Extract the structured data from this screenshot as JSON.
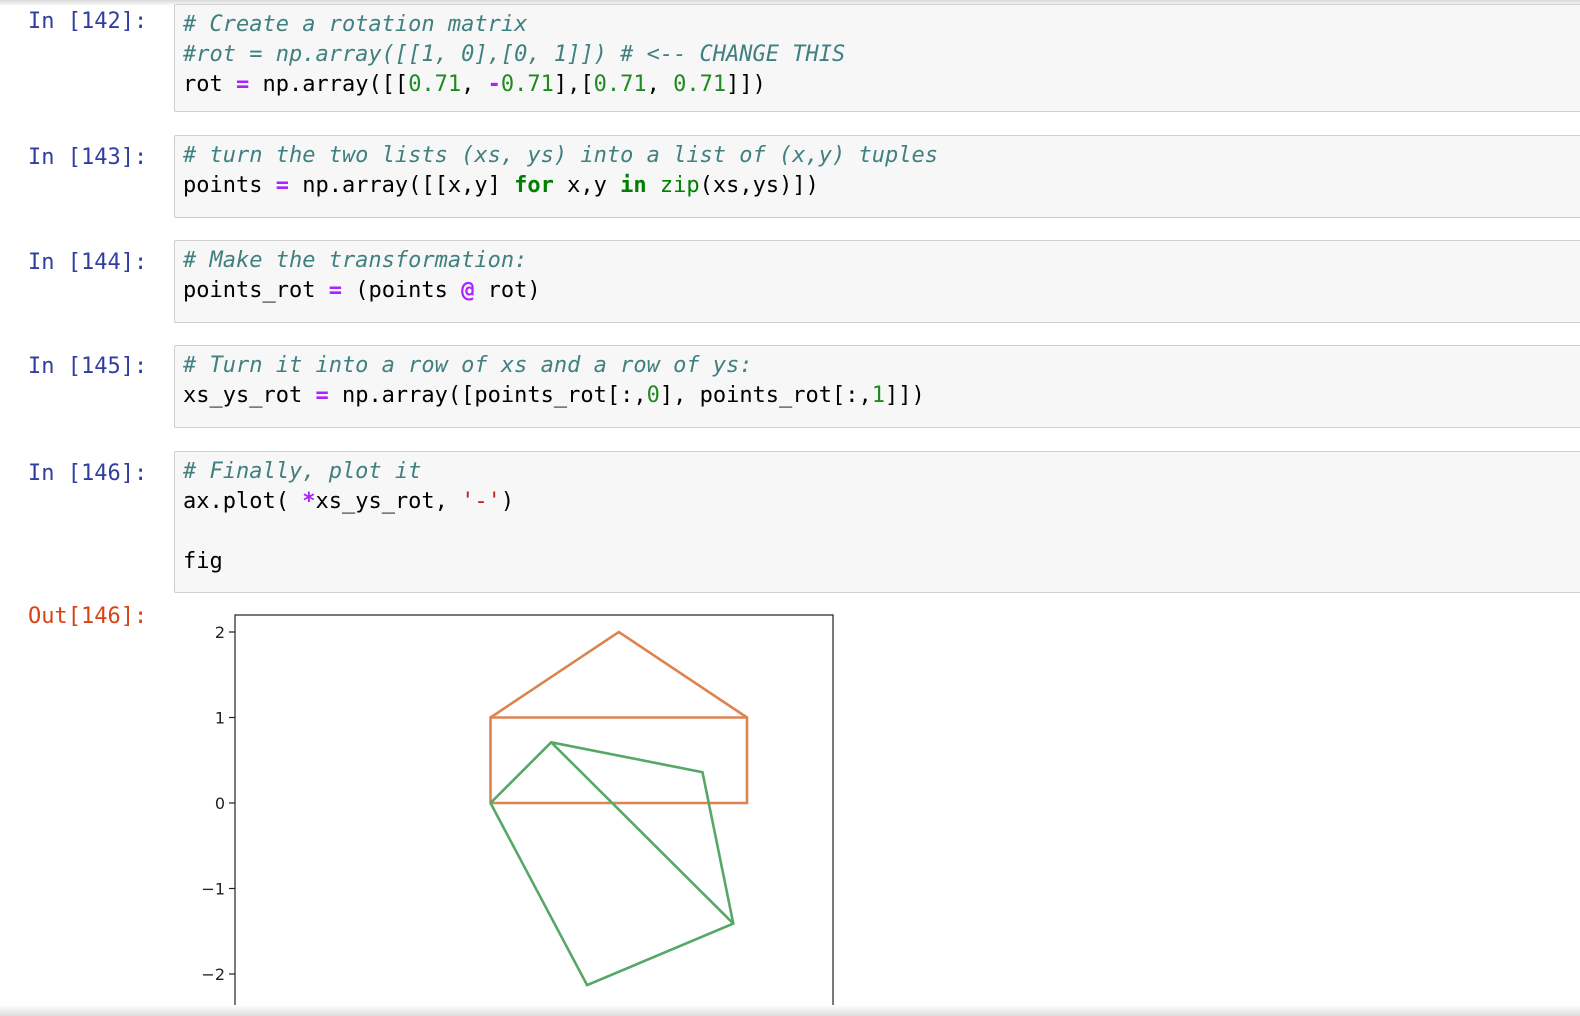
{
  "cells": [
    {
      "prompt": "In [142]:",
      "lines": [
        [
          [
            "cm",
            "# Create a rotation matrix"
          ]
        ],
        [
          [
            "cm",
            "#rot = np.array([[1, 0],[0, 1]]) # <-- CHANGE THIS"
          ]
        ],
        [
          [
            "t",
            "rot "
          ],
          [
            "op",
            "="
          ],
          [
            "t",
            " np.array([["
          ],
          [
            "num",
            "0.71"
          ],
          [
            "t",
            ", "
          ],
          [
            "op",
            "-"
          ],
          [
            "num",
            "0.71"
          ],
          [
            "t",
            "],["
          ],
          [
            "num",
            "0.71"
          ],
          [
            "t",
            ", "
          ],
          [
            "num",
            "0.71"
          ],
          [
            "t",
            "]])"
          ]
        ]
      ]
    },
    {
      "prompt": "In [143]:",
      "lines": [
        [
          [
            "cm",
            "# turn the two lists (xs, ys) into a list of (x,y) tuples"
          ]
        ],
        [
          [
            "t",
            "points "
          ],
          [
            "op",
            "="
          ],
          [
            "t",
            " np.array([[x,y] "
          ],
          [
            "kw",
            "for"
          ],
          [
            "t",
            " x,y "
          ],
          [
            "kw",
            "in"
          ],
          [
            "t",
            " "
          ],
          [
            "bi",
            "zip"
          ],
          [
            "t",
            "(xs,ys)])"
          ]
        ]
      ]
    },
    {
      "prompt": "In [144]:",
      "lines": [
        [
          [
            "cm",
            "# Make the transformation:"
          ]
        ],
        [
          [
            "t",
            "points_rot "
          ],
          [
            "op",
            "="
          ],
          [
            "t",
            " (points "
          ],
          [
            "op",
            "@"
          ],
          [
            "t",
            " rot)"
          ]
        ]
      ]
    },
    {
      "prompt": "In [145]:",
      "lines": [
        [
          [
            "cm",
            "# Turn it into a row of xs and a row of ys:"
          ]
        ],
        [
          [
            "t",
            "xs_ys_rot "
          ],
          [
            "op",
            "="
          ],
          [
            "t",
            " np.array([points_rot[:,"
          ],
          [
            "num",
            "0"
          ],
          [
            "t",
            "], points_rot[:,"
          ],
          [
            "num",
            "1"
          ],
          [
            "t",
            "]])"
          ]
        ]
      ]
    },
    {
      "prompt": "In [146]:",
      "lines": [
        [
          [
            "cm",
            "# Finally, plot it"
          ]
        ],
        [
          [
            "t",
            "ax.plot( "
          ],
          [
            "op",
            "*"
          ],
          [
            "t",
            "xs_ys_rot, "
          ],
          [
            "str",
            "'-'"
          ],
          [
            "t",
            ")"
          ]
        ],
        [],
        [
          [
            "t",
            "fig"
          ]
        ]
      ]
    }
  ],
  "output_prompt": "Out[146]:",
  "colors": {
    "orange": "#dd8452",
    "green": "#55a868"
  },
  "chart_data": {
    "type": "line",
    "yticks": [
      2,
      1,
      0,
      -1,
      -2
    ],
    "ytick_labels": [
      "2",
      "1",
      "0",
      "−1",
      "−2"
    ],
    "ylim": [
      -2.3,
      2.2
    ],
    "xlim": [
      -2,
      5
    ],
    "series": [
      {
        "color": "orange",
        "points": [
          [
            1,
            0
          ],
          [
            1,
            1
          ],
          [
            2.5,
            2
          ],
          [
            4,
            1
          ],
          [
            4,
            0
          ],
          [
            1,
            0
          ],
          [
            1,
            1
          ],
          [
            4,
            1
          ]
        ]
      },
      {
        "color": "green",
        "points": [
          [
            1,
            0
          ],
          [
            1.71,
            0.71
          ],
          [
            3.48,
            0.36
          ],
          [
            3.84,
            -1.41
          ],
          [
            2.13,
            -2.13
          ],
          [
            1,
            0
          ]
        ]
      },
      {
        "color": "green",
        "points": [
          [
            1.71,
            0.71
          ],
          [
            3.84,
            -1.41
          ]
        ]
      }
    ]
  }
}
